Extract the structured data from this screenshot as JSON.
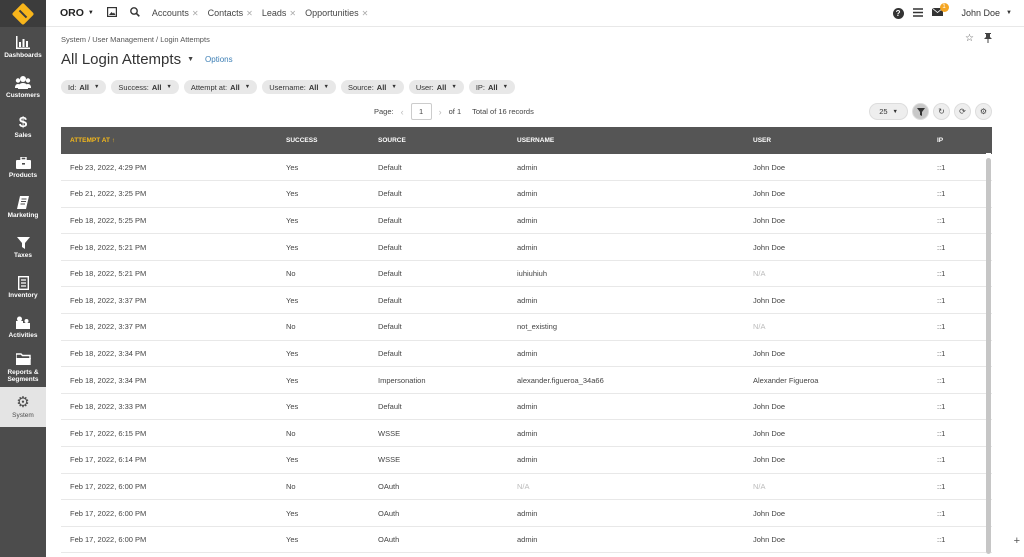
{
  "sidebar": {
    "items": [
      {
        "label": "Dashboards",
        "icon": "dashboards-icon"
      },
      {
        "label": "Customers",
        "icon": "customers-icon"
      },
      {
        "label": "Sales",
        "icon": "sales-icon"
      },
      {
        "label": "Products",
        "icon": "products-icon"
      },
      {
        "label": "Marketing",
        "icon": "marketing-icon"
      },
      {
        "label": "Taxes",
        "icon": "taxes-icon"
      },
      {
        "label": "Inventory",
        "icon": "inventory-icon"
      },
      {
        "label": "Activities",
        "icon": "activities-icon"
      },
      {
        "label": "Reports & Segments",
        "icon": "reports-icon"
      },
      {
        "label": "System",
        "icon": "gear-icon"
      }
    ]
  },
  "topbar": {
    "brand": "ORO",
    "pinned": [
      "Accounts",
      "Contacts",
      "Leads",
      "Opportunities"
    ],
    "notification_count": "1",
    "user_name": "John Doe"
  },
  "breadcrumb": "System / User Management / Login Attempts",
  "page_title": "All Login Attempts",
  "options_label": "Options",
  "filters": [
    {
      "name": "Id:",
      "value": "All"
    },
    {
      "name": "Success:",
      "value": "All"
    },
    {
      "name": "Attempt at:",
      "value": "All"
    },
    {
      "name": "Username:",
      "value": "All"
    },
    {
      "name": "Source:",
      "value": "All"
    },
    {
      "name": "User:",
      "value": "All"
    },
    {
      "name": "IP:",
      "value": "All"
    }
  ],
  "pager": {
    "page_label": "Page:",
    "current": "1",
    "of_label": "of 1",
    "total": "Total of 16 records",
    "per_page": "25"
  },
  "table": {
    "columns": [
      "ATTEMPT AT ↑",
      "SUCCESS",
      "SOURCE",
      "USERNAME",
      "USER",
      "IP"
    ],
    "rows": [
      [
        "Feb 23, 2022, 4:29 PM",
        "Yes",
        "Default",
        "admin",
        "John Doe",
        "::1"
      ],
      [
        "Feb 21, 2022, 3:25 PM",
        "Yes",
        "Default",
        "admin",
        "John Doe",
        "::1"
      ],
      [
        "Feb 18, 2022, 5:25 PM",
        "Yes",
        "Default",
        "admin",
        "John Doe",
        "::1"
      ],
      [
        "Feb 18, 2022, 5:21 PM",
        "Yes",
        "Default",
        "admin",
        "John Doe",
        "::1"
      ],
      [
        "Feb 18, 2022, 5:21 PM",
        "No",
        "Default",
        "iuhiuhiuh",
        "N/A",
        "::1"
      ],
      [
        "Feb 18, 2022, 3:37 PM",
        "Yes",
        "Default",
        "admin",
        "John Doe",
        "::1"
      ],
      [
        "Feb 18, 2022, 3:37 PM",
        "No",
        "Default",
        "not_existing",
        "N/A",
        "::1"
      ],
      [
        "Feb 18, 2022, 3:34 PM",
        "Yes",
        "Default",
        "admin",
        "John Doe",
        "::1"
      ],
      [
        "Feb 18, 2022, 3:34 PM",
        "Yes",
        "Impersonation",
        "alexander.figueroa_34a66",
        "Alexander Figueroa",
        "::1"
      ],
      [
        "Feb 18, 2022, 3:33 PM",
        "Yes",
        "Default",
        "admin",
        "John Doe",
        "::1"
      ],
      [
        "Feb 17, 2022, 6:15 PM",
        "No",
        "WSSE",
        "admin",
        "John Doe",
        "::1"
      ],
      [
        "Feb 17, 2022, 6:14 PM",
        "Yes",
        "WSSE",
        "admin",
        "John Doe",
        "::1"
      ],
      [
        "Feb 17, 2022, 6:00 PM",
        "No",
        "OAuth",
        "N/A",
        "N/A",
        "::1"
      ],
      [
        "Feb 17, 2022, 6:00 PM",
        "Yes",
        "OAuth",
        "admin",
        "John Doe",
        "::1"
      ],
      [
        "Feb 17, 2022, 6:00 PM",
        "Yes",
        "OAuth",
        "admin",
        "John Doe",
        "::1"
      ]
    ]
  },
  "colors": {
    "sidebar": "#4c4c4c",
    "header": "#555555",
    "accent": "#f5b91b",
    "link": "#3d7fb5"
  }
}
